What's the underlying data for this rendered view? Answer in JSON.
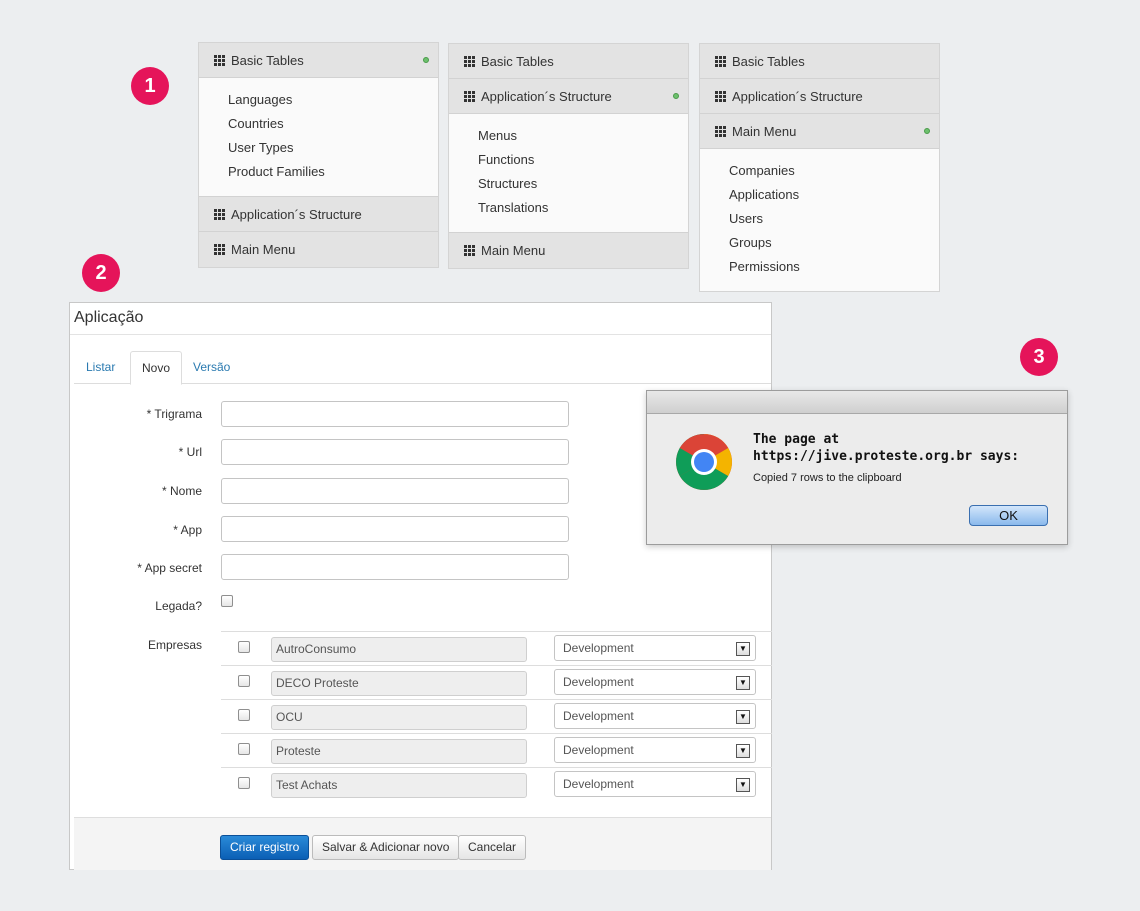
{
  "badges": [
    "1",
    "2",
    "3"
  ],
  "accordion_1": {
    "head1": "Basic Tables",
    "items": [
      "Languages",
      "Countries",
      "User Types",
      "Product Families"
    ],
    "head2": "Application´s Structure",
    "head3": "Main Menu"
  },
  "accordion_2": {
    "head1": "Basic Tables",
    "head2": "Application´s Structure",
    "items": [
      "Menus",
      "Functions",
      "Structures",
      "Translations"
    ],
    "head3": "Main Menu"
  },
  "accordion_3": {
    "head1": "Basic Tables",
    "head2": "Application´s Structure",
    "head3": "Main Menu",
    "items": [
      "Companies",
      "Applications",
      "Users",
      "Groups",
      "Permissions"
    ]
  },
  "form": {
    "title": "Aplicação",
    "tabs": [
      "Listar",
      "Novo",
      "Versão"
    ],
    "active_tab": "Novo",
    "fields": [
      {
        "label": "* Trigrama",
        "value": ""
      },
      {
        "label": "* Url",
        "value": ""
      },
      {
        "label": "* Nome",
        "value": ""
      },
      {
        "label": "* App",
        "value": ""
      },
      {
        "label": "* App secret",
        "value": ""
      }
    ],
    "legada_label": "Legada?",
    "empresas_label": "Empresas",
    "empresas": [
      {
        "name": "AutroConsumo",
        "env": "Development"
      },
      {
        "name": "DECO Proteste",
        "env": "Development"
      },
      {
        "name": "OCU",
        "env": "Development"
      },
      {
        "name": "Proteste",
        "env": "Development"
      },
      {
        "name": "Test Achats",
        "env": "Development"
      }
    ],
    "buttons": {
      "create": "Criar registro",
      "save_add": "Salvar & Adicionar novo",
      "cancel": "Cancelar"
    }
  },
  "dialog": {
    "title": "The page at https://jive.proteste.org.br says:",
    "message": "Copied 7 rows to the clipboard",
    "ok": "OK"
  },
  "colors": {
    "badge": "#e5145a",
    "primary_button": "#0b5fb5",
    "link": "#2a7ab0",
    "active_dot": "#6dc06d"
  }
}
